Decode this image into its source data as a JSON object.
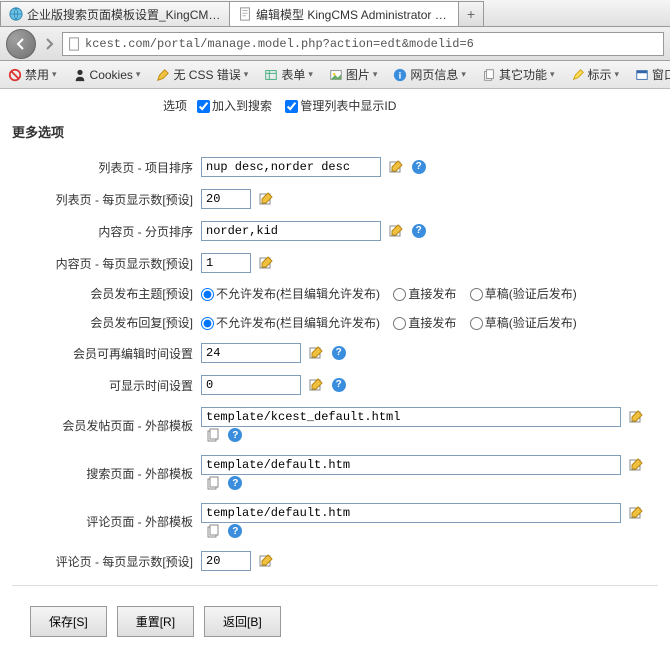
{
  "tabs": {
    "t1": "企业版搜索页面模板设置_KingCMS官…",
    "t2": "编辑模型 KingCMS Administrator P…"
  },
  "url": "kcest.com/portal/manage.model.php?action=edt&modelid=6",
  "toolbar": {
    "disable": "禁用",
    "cookies": "Cookies",
    "nocss": "无 CSS 错误",
    "form": "表单",
    "image": "图片",
    "info": "网页信息",
    "other": "其它功能",
    "mark": "标示",
    "window": "窗口"
  },
  "top": {
    "opt_label": "选项",
    "chk1": "加入到搜索",
    "chk2": "管理列表中显示ID"
  },
  "section": "更多选项",
  "rows": {
    "r1": {
      "label": "列表页 - 项目排序",
      "value": "nup desc,norder desc"
    },
    "r2": {
      "label": "列表页 - 每页显示数[预设]",
      "value": "20"
    },
    "r3": {
      "label": "内容页 - 分页排序",
      "value": "norder,kid"
    },
    "r4": {
      "label": "内容页 - 每页显示数[预设]",
      "value": "1"
    },
    "r5": {
      "label": "会员发布主题[预设]"
    },
    "r6": {
      "label": "会员发布回复[预设]"
    },
    "radios": {
      "o1": "不允许发布(栏目编辑允许发布)",
      "o2": "直接发布",
      "o3": "草稿(验证后发布)"
    },
    "r7": {
      "label": "会员可再编辑时间设置",
      "value": "24"
    },
    "r8": {
      "label": "可显示时间设置",
      "value": "0"
    },
    "r9": {
      "label": "会员发帖页面 - 外部模板",
      "value": "template/kcest_default.html"
    },
    "r10": {
      "label": "搜索页面 - 外部模板",
      "value": "template/default.htm"
    },
    "r11": {
      "label": "评论页面 - 外部模板",
      "value": "template/default.htm"
    },
    "r12": {
      "label": "评论页 - 每页显示数[预设]",
      "value": "20"
    }
  },
  "buttons": {
    "save": "保存[S]",
    "reset": "重置[R]",
    "back": "返回[B]"
  }
}
